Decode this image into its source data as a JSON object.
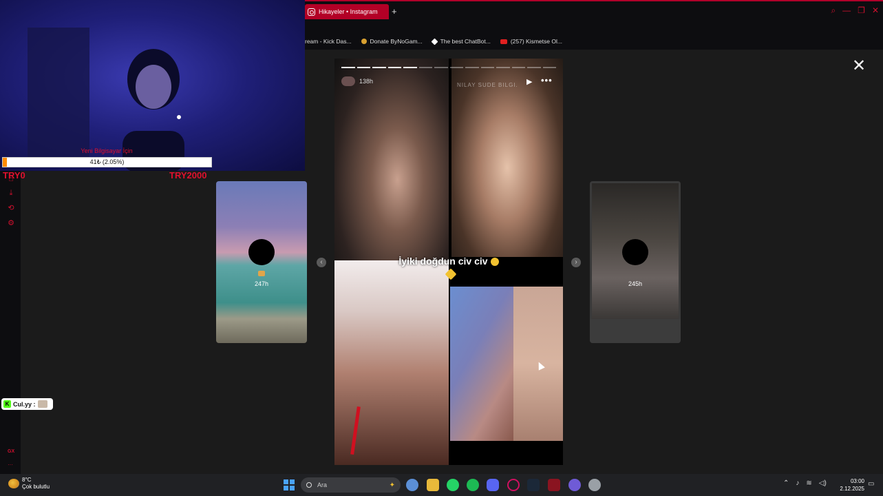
{
  "browser": {
    "tab_title": "Hikayeler • Instagram",
    "new_tab": "+",
    "window_controls": [
      "search-icon",
      "minimize-icon",
      "restore-icon",
      "close-icon"
    ],
    "bookmarks": [
      {
        "label": "ream - Kick Das...",
        "icon": "none"
      },
      {
        "label": "Donate ByNoGam...",
        "icon": "coin-icon"
      },
      {
        "label": "The best ChatBot...",
        "icon": "diamond-icon"
      },
      {
        "label": "(257) Kismetse Ol...",
        "icon": "youtube-icon"
      }
    ]
  },
  "stream_overlay": {
    "donation_title": "Yeni Bilgisayar İçin",
    "progress_text": "41₺ (2.05%)",
    "progress_fraction": 0.0205,
    "goal_min": "TRY0",
    "goal_max": "TRY2000",
    "chat_user": "Cul.yy :",
    "chat_platform": "K"
  },
  "story_viewer": {
    "close_glyph": "✕",
    "left_story_time": "247h",
    "right_story_time": "245h",
    "prev_glyph": "‹",
    "next_glyph": "›",
    "active": {
      "time": "138h",
      "faded_name": "NILAY SUDE BILGI.",
      "caption": "İyiki doğdun civ civ",
      "play_glyph": "▶",
      "more_glyph": "•••",
      "segments_total": 14,
      "segments_done": 5
    }
  },
  "sidebar": {
    "gx_label": "GX",
    "more_glyph": "···"
  },
  "taskbar": {
    "weather_temp": "8°C",
    "weather_desc": "Çok bulutlu",
    "search_placeholder": "Ara",
    "clock_time": "03:00",
    "clock_date": "2.12.2025"
  },
  "colors": {
    "accent_red": "#d0102e",
    "tab_red": "#b30026",
    "progress_orange": "#ff8c00"
  }
}
